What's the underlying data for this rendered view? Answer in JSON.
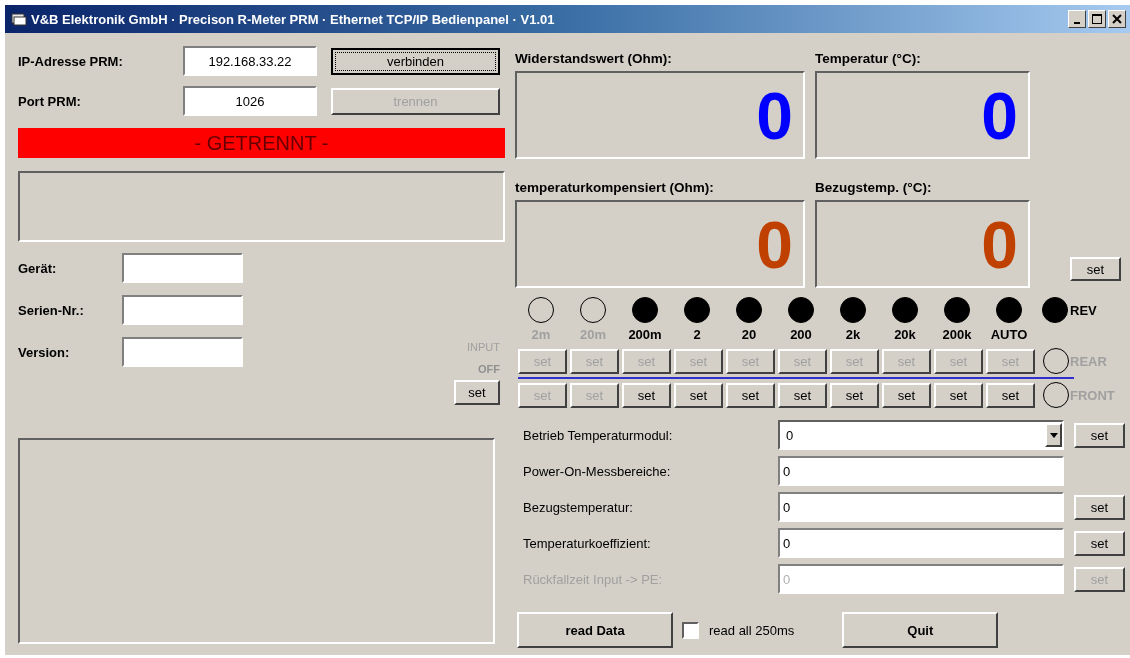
{
  "window": {
    "title": "V&B Elektronik GmbH · Precison R-Meter PRM · Ethernet TCP/IP Bedienpanel · V1.01"
  },
  "connection": {
    "ip_label": "IP-Adresse PRM:",
    "ip_value": "192.168.33.22",
    "port_label": "Port PRM:",
    "port_value": "1026",
    "buttons": [
      {
        "label": "verbinden",
        "disabled": false,
        "focused": true
      },
      {
        "label": "trennen",
        "disabled": true,
        "focused": false
      }
    ],
    "status": "- GETRENNT -"
  },
  "device": [
    {
      "label": "Gerät:"
    },
    {
      "label": "Serien-Nr.:"
    },
    {
      "label": "Version:"
    }
  ],
  "input": {
    "label": "INPUT",
    "state": "OFF",
    "button": {
      "label": "set",
      "disabled": false
    }
  },
  "displays": [
    {
      "label": "Widerstandswert (Ohm):",
      "value": "0",
      "color": "#0000ff"
    },
    {
      "label": "Temperatur (°C):",
      "value": "0",
      "color": "#0000ff"
    },
    {
      "label": "temperaturkompensiert (Ohm):",
      "value": "0",
      "color": "#c04000"
    },
    {
      "label": "Bezugstemp. (°C):",
      "value": "0",
      "color": "#c04000"
    }
  ],
  "display_set": {
    "label": "set",
    "disabled": false
  },
  "ranges": [
    {
      "label": "2m",
      "on": false,
      "enabled": false
    },
    {
      "label": "20m",
      "on": false,
      "enabled": false
    },
    {
      "label": "200m",
      "on": true,
      "enabled": true
    },
    {
      "label": "2",
      "on": true,
      "enabled": true
    },
    {
      "label": "20",
      "on": true,
      "enabled": true
    },
    {
      "label": "200",
      "on": true,
      "enabled": true
    },
    {
      "label": "2k",
      "on": true,
      "enabled": true
    },
    {
      "label": "20k",
      "on": true,
      "enabled": true
    },
    {
      "label": "200k",
      "on": true,
      "enabled": true
    },
    {
      "label": "AUTO",
      "on": true,
      "enabled": true
    }
  ],
  "rev": {
    "label": "REV",
    "on": true
  },
  "set_rows": [
    {
      "buttons": [
        {
          "label": "set",
          "disabled": true
        },
        {
          "label": "set",
          "disabled": true
        },
        {
          "label": "set",
          "disabled": true
        },
        {
          "label": "set",
          "disabled": true
        },
        {
          "label": "set",
          "disabled": true
        },
        {
          "label": "set",
          "disabled": true
        },
        {
          "label": "set",
          "disabled": true
        },
        {
          "label": "set",
          "disabled": true
        },
        {
          "label": "set",
          "disabled": true
        },
        {
          "label": "set",
          "disabled": true
        }
      ],
      "radio": {
        "label": "REAR",
        "selected": false,
        "disabled": true
      }
    },
    {
      "buttons": [
        {
          "label": "set",
          "disabled": true
        },
        {
          "label": "set",
          "disabled": true
        },
        {
          "label": "set",
          "disabled": false
        },
        {
          "label": "set",
          "disabled": false
        },
        {
          "label": "set",
          "disabled": false
        },
        {
          "label": "set",
          "disabled": false
        },
        {
          "label": "set",
          "disabled": false
        },
        {
          "label": "set",
          "disabled": false
        },
        {
          "label": "set",
          "disabled": false
        },
        {
          "label": "set",
          "disabled": false
        }
      ],
      "radio": {
        "label": "FRONT",
        "selected": false,
        "disabled": true
      }
    }
  ],
  "settings": [
    {
      "kind": "dropdown",
      "label": "Betrieb Temperaturmodul:",
      "value": "0",
      "disabled": false,
      "button": "set"
    },
    {
      "kind": "text",
      "label": "Power-On-Messbereiche:",
      "value": "0",
      "disabled": false
    },
    {
      "kind": "text",
      "label": "Bezugstemperatur:",
      "value": "0",
      "disabled": false,
      "button": "set"
    },
    {
      "kind": "text",
      "label": "Temperaturkoeffizient:",
      "value": "0",
      "disabled": false,
      "button": "set"
    },
    {
      "kind": "text",
      "label": "Rückfallzeit Input -> PE:",
      "value": "0",
      "disabled": true,
      "button": "set"
    }
  ],
  "footer": {
    "read_button": "read Data",
    "auto_read": {
      "label": "read all 250ms",
      "checked": false
    },
    "quit_button": "Quit"
  }
}
